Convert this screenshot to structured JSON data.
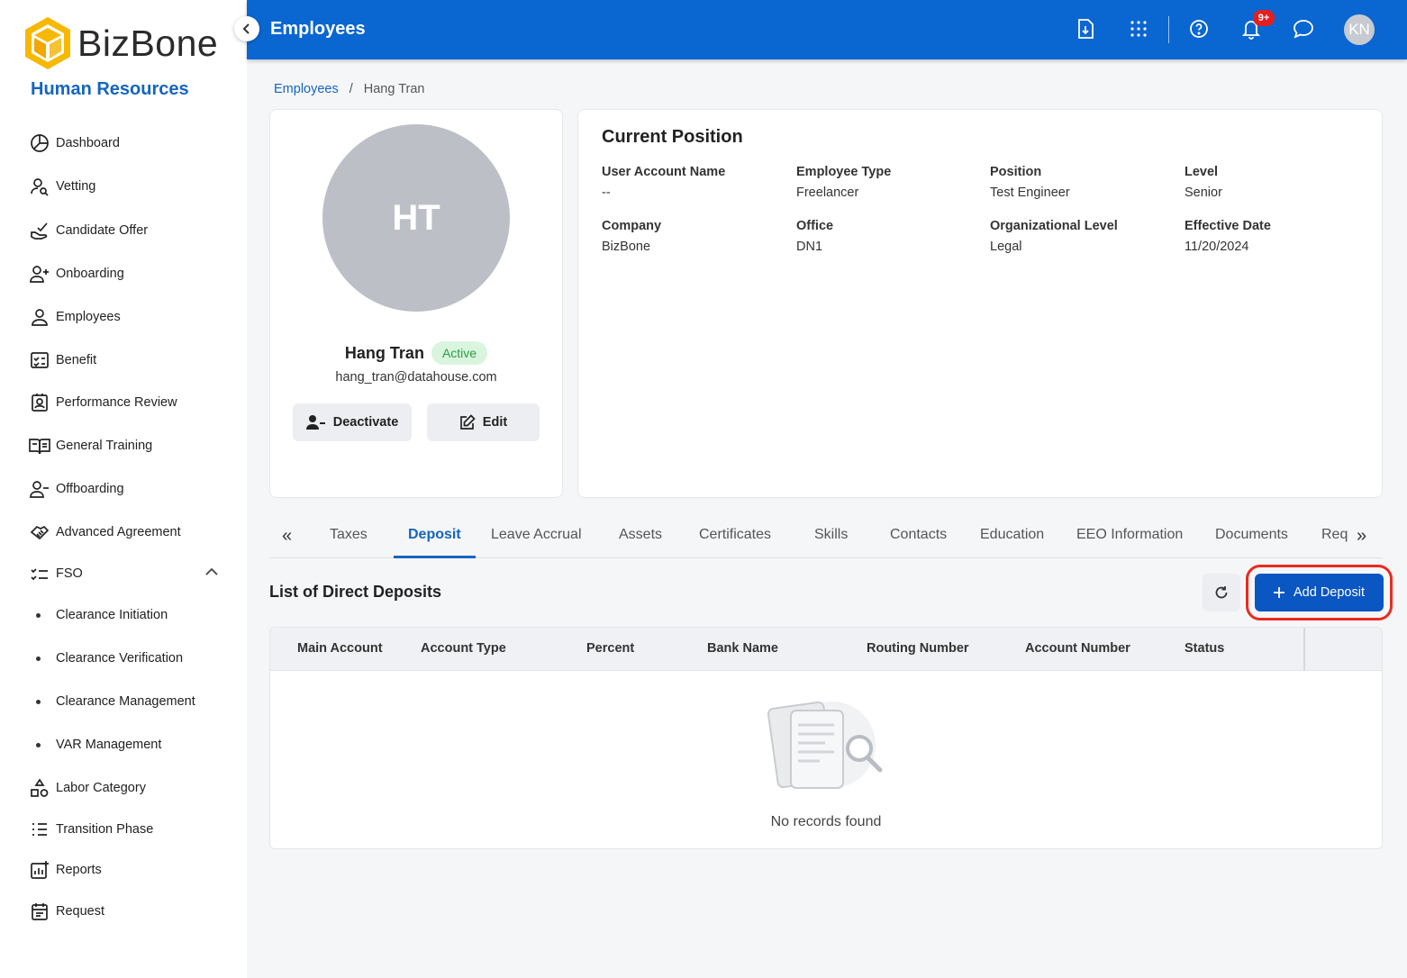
{
  "brand": {
    "name": "BizBone",
    "module": "Human Resources"
  },
  "sidebar": {
    "items": [
      {
        "label": "Dashboard",
        "icon": "dashboard-icon"
      },
      {
        "label": "Vetting",
        "icon": "vetting-icon"
      },
      {
        "label": "Candidate Offer",
        "icon": "candidate-offer-icon"
      },
      {
        "label": "Onboarding",
        "icon": "onboarding-icon"
      },
      {
        "label": "Employees",
        "icon": "employees-icon"
      },
      {
        "label": "Benefit",
        "icon": "benefit-icon"
      },
      {
        "label": "Performance Review",
        "icon": "performance-review-icon"
      },
      {
        "label": "General Training",
        "icon": "general-training-icon"
      },
      {
        "label": "Offboarding",
        "icon": "offboarding-icon"
      },
      {
        "label": "Advanced Agreement",
        "icon": "advanced-agreement-icon"
      },
      {
        "label": "FSO",
        "icon": "fso-icon"
      },
      {
        "label": "Labor Category",
        "icon": "labor-category-icon"
      },
      {
        "label": "Transition Phase",
        "icon": "transition-phase-icon"
      },
      {
        "label": "Reports",
        "icon": "reports-icon"
      },
      {
        "label": "Request",
        "icon": "request-icon"
      }
    ],
    "fso_subitems": [
      {
        "label": "Clearance Initiation"
      },
      {
        "label": "Clearance Verification"
      },
      {
        "label": "Clearance Management"
      },
      {
        "label": "VAR Management"
      }
    ]
  },
  "header": {
    "title": "Employees",
    "notification_count": "9+",
    "user_initials": "KN"
  },
  "breadcrumb": {
    "parent": "Employees",
    "separator": "/",
    "current": "Hang Tran"
  },
  "profile": {
    "initials": "HT",
    "name": "Hang Tran",
    "status": "Active",
    "email": "hang_tran@datahouse.com",
    "deactivate_label": "Deactivate",
    "edit_label": "Edit"
  },
  "position": {
    "title": "Current Position",
    "fields": [
      {
        "label": "User Account Name",
        "value": "--"
      },
      {
        "label": "Employee Type",
        "value": "Freelancer"
      },
      {
        "label": "Position",
        "value": "Test Engineer"
      },
      {
        "label": "Level",
        "value": "Senior"
      },
      {
        "label": "Company",
        "value": "BizBone"
      },
      {
        "label": "Office",
        "value": "DN1"
      },
      {
        "label": "Organizational Level",
        "value": "Legal"
      },
      {
        "label": "Effective Date",
        "value": "11/20/2024"
      }
    ]
  },
  "tabs": {
    "prev_label": "«",
    "next_label": "»",
    "items": [
      "Taxes",
      "Deposit",
      "Leave Accrual",
      "Assets",
      "Certificates",
      "Skills",
      "Contacts",
      "Education",
      "EEO Information",
      "Documents",
      "Req"
    ],
    "active": "Deposit"
  },
  "deposits": {
    "title": "List of Direct Deposits",
    "add_label": "Add Deposit",
    "columns": [
      "Main Account",
      "Account Type",
      "Percent",
      "Bank Name",
      "Routing Number",
      "Account Number",
      "Status"
    ],
    "rows": [],
    "empty_text": "No records found"
  },
  "colors": {
    "primary": "#0a66d1",
    "active_green": "#2a9d43",
    "highlight_red": "#ec2a1f"
  }
}
